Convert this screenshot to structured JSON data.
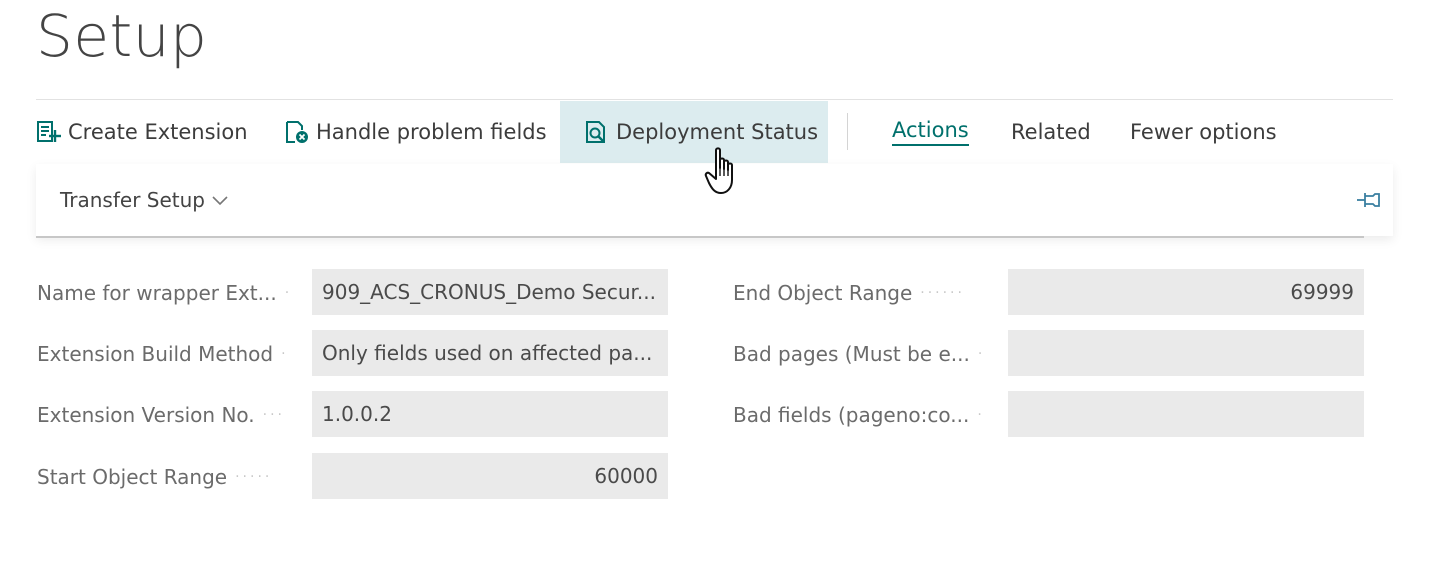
{
  "page": {
    "title": "Setup"
  },
  "actions": {
    "create_extension": "Create Extension",
    "handle_problem_fields": "Handle problem fields",
    "deployment_status": "Deployment Status"
  },
  "menu": {
    "actions": "Actions",
    "related": "Related",
    "fewer_options": "Fewer options"
  },
  "subbar": {
    "transfer_setup": "Transfer Setup"
  },
  "fields": {
    "wrapper_name": {
      "label": "Name for wrapper Ext...",
      "value": "909_ACS_CRONUS_Demo Secur..."
    },
    "build_method": {
      "label": "Extension Build Method",
      "value": "Only fields used on affected pa..."
    },
    "version_no": {
      "label": "Extension Version No.",
      "value": "1.0.0.2"
    },
    "start_range": {
      "label": "Start Object Range",
      "value": "60000"
    },
    "end_range": {
      "label": "End Object Range",
      "value": "69999"
    },
    "bad_pages": {
      "label": "Bad pages (Must be e...",
      "value": ""
    },
    "bad_fields": {
      "label": "Bad fields (pageno:co...",
      "value": ""
    }
  },
  "colors": {
    "accent": "#00706c",
    "hover": "#dcecef",
    "field_bg": "#eaeaea"
  }
}
